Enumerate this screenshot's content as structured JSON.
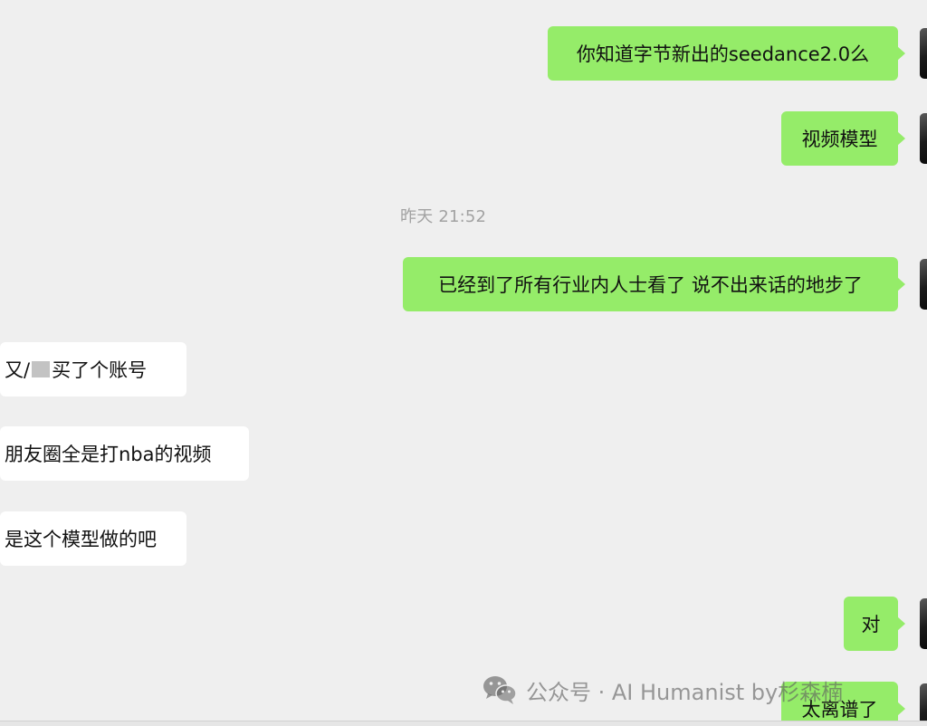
{
  "messages": [
    {
      "side": "outgoing",
      "text": "你知道字节新出的seedance2.0么"
    },
    {
      "side": "outgoing",
      "text": "视频模型"
    },
    {
      "side": "outgoing",
      "text": "已经到了所有行业内人士看了 说不出来话的地步了"
    },
    {
      "side": "incoming",
      "text_before_redaction": "又/",
      "text_after_redaction": "买了个账号"
    },
    {
      "side": "incoming",
      "text": "朋友圈全是打nba的视频"
    },
    {
      "side": "incoming",
      "text": "是这个模型做的吧"
    },
    {
      "side": "outgoing",
      "text": "对"
    },
    {
      "side": "outgoing",
      "text": "太离谱了"
    }
  ],
  "timestamp": "昨天 21:52",
  "watermark": {
    "text": "公众号 · AI Humanist by杉森楠",
    "icon": "wechat-logo-icon"
  },
  "colors": {
    "background": "#efefef",
    "outgoing_bubble": "#95ec69",
    "incoming_bubble": "#ffffff",
    "timestamp_text": "#a2a2a2"
  }
}
